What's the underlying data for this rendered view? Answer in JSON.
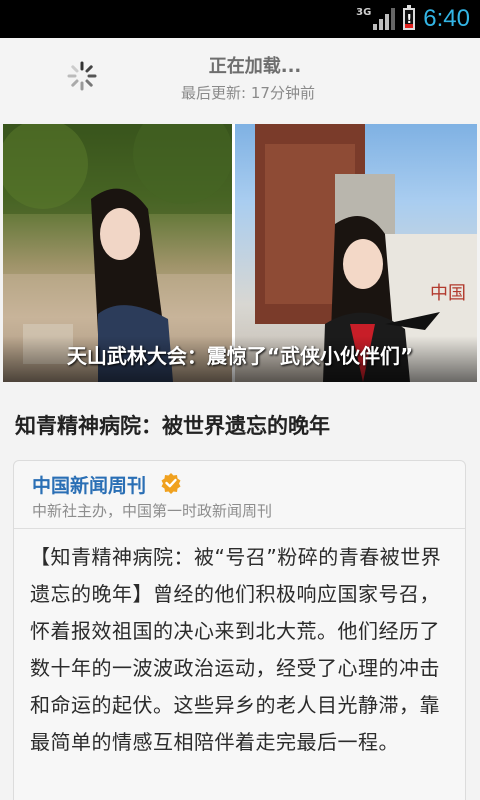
{
  "status_bar": {
    "network": "3G",
    "time": "6:40",
    "battery_level": 0.25,
    "colors": {
      "clock": "#33b5e5",
      "battery_alert": "#e0201d"
    }
  },
  "refresh": {
    "title": "正在加载...",
    "last_update": "最后更新: 17分钟前"
  },
  "banner": {
    "caption": "天山武林大会：震惊了“武侠小伙伴们”"
  },
  "article": {
    "title": "知青精神病院：被世界遗忘的晚年",
    "account": {
      "name": "中国新闻周刊",
      "description": "中新社主办，中国第一时政新闻周刊",
      "verified_color": "#f0a11f"
    },
    "body": "【知青精神病院：被“号召”粉碎的青春被世界遗忘的晚年】曾经的他们积极响应国家号召，怀着报效祖国的决心来到北大荒。他们经历了数十年的一波波政治运动，经受了心理的冲击和命运的起伏。这些异乡的老人目光静滞，靠最简单的情感互相陪伴着走完最后一程。"
  }
}
